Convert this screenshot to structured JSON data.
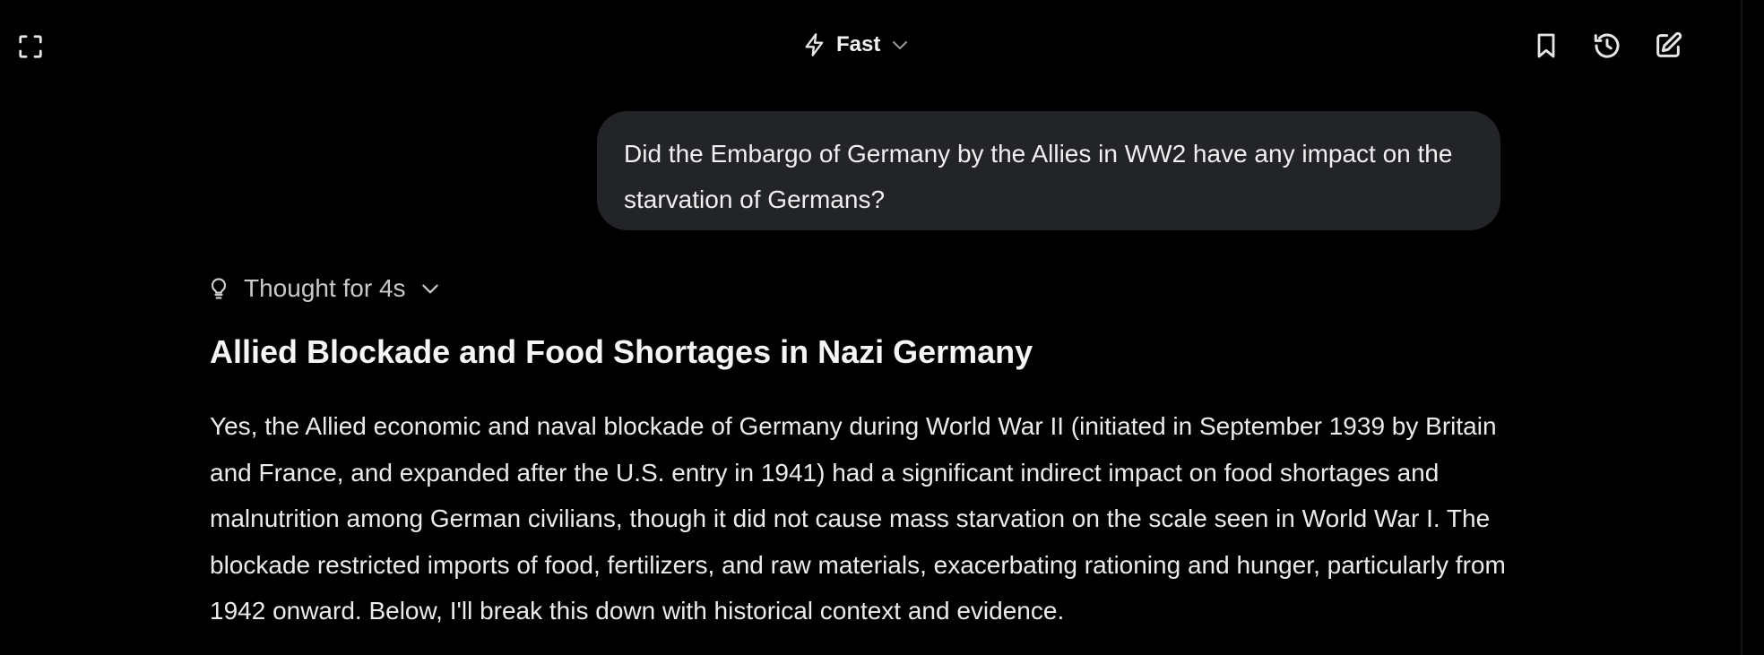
{
  "toolbar": {
    "model_label": "Fast",
    "icons": {
      "left": "fullscreen-icon",
      "model": "bolt-icon",
      "model_caret": "chevron-down-icon",
      "bookmark": "bookmark-icon",
      "history": "history-icon",
      "new_chat": "edit-icon"
    }
  },
  "conversation": {
    "user_message": "Did the Embargo of Germany by the Allies in WW2 have any impact on the starvation of Germans?",
    "thought_label": "Thought for 4s",
    "answer_heading": "Allied Blockade and Food Shortages in Nazi Germany",
    "answer_paragraph": "Yes, the Allied economic and naval blockade of Germany during World War II (initiated in September 1939 by Britain and France, and expanded after the U.S. entry in 1941) had a significant indirect impact on food shortages and malnutrition among German civilians, though it did not cause mass starvation on the scale seen in World War I. The blockade restricted imports of food, fertilizers, and raw materials, exacerbating rationing and hunger, particularly from 1942 onward. Below, I'll break this down with historical context and evidence."
  },
  "colors": {
    "background": "#000000",
    "bubble": "#222427",
    "text": "#ebebeb",
    "muted": "#c9c9c9"
  }
}
